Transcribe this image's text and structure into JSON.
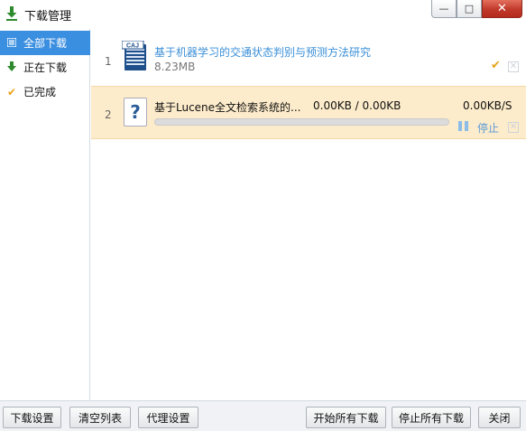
{
  "window": {
    "title": "下载管理",
    "minimize_glyph": "—",
    "maximize_glyph": "□",
    "close_glyph": "✕"
  },
  "sidebar": {
    "items": [
      {
        "label": "全部下载",
        "icon": "list-icon",
        "active": true
      },
      {
        "label": "正在下载",
        "icon": "download-arrow-icon",
        "active": false
      },
      {
        "label": "已完成",
        "icon": "checkmark-icon",
        "active": false
      }
    ]
  },
  "downloads": [
    {
      "index": "1",
      "file_type": "CAJ",
      "title": "基于机器学习的交通状态判别与预测方法研究",
      "size": "8.23MB",
      "status": "completed"
    },
    {
      "index": "2",
      "file_type": "?",
      "title": "基于Lucene全文检索系统的...",
      "progress_text": "0.00KB / 0.00KB",
      "speed": "0.00KB/S",
      "progress": 0,
      "stop_label": "停止",
      "status": "downloading"
    }
  ],
  "toolbar": {
    "download_settings": "下载设置",
    "clear_list": "清空列表",
    "proxy_settings": "代理设置",
    "start_all": "开始所有下载",
    "stop_all": "停止所有下载",
    "close": "关闭"
  },
  "colors": {
    "accent": "#3b8fe0",
    "link": "#3a8fd8",
    "active_row_bg": "#fdeccb",
    "done_check": "#e8a317",
    "close_button": "#c0392b",
    "download_arrow": "#2e8b2e"
  }
}
